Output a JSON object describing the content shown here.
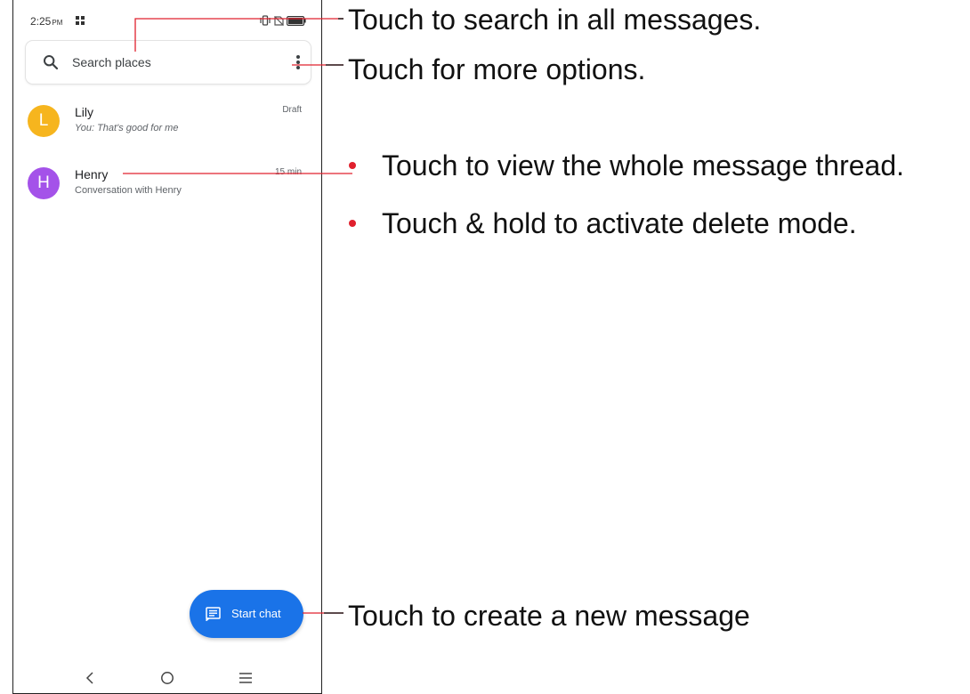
{
  "status_bar": {
    "time": "2:25",
    "ampm": "PM"
  },
  "search": {
    "placeholder": "Search places"
  },
  "conversations": [
    {
      "avatar_letter": "L",
      "avatar_color": "#f6b51e",
      "name": "Lily",
      "snippet": "You: That's good for me",
      "meta": "Draft"
    },
    {
      "avatar_letter": "H",
      "avatar_color": "#a452e9",
      "name": "Henry",
      "snippet": "Conversation with Henry",
      "meta": "15 min"
    }
  ],
  "fab": {
    "label": "Start chat",
    "color": "#1a73e8"
  },
  "callouts": {
    "search": "Touch to search in all messages.",
    "more_options": "Touch for more options.",
    "thread_bullets": [
      "Touch to view the whole message thread.",
      "Touch & hold to activate delete mode."
    ],
    "new_message": "Touch to create a new message"
  },
  "colors": {
    "callout_line": "#e0202d",
    "bullet": "#e0202d"
  },
  "icons": {
    "search": "search-icon",
    "more": "more-vert-icon",
    "fab": "message-icon",
    "nav": [
      "back-icon",
      "home-icon",
      "recents-icon"
    ]
  }
}
